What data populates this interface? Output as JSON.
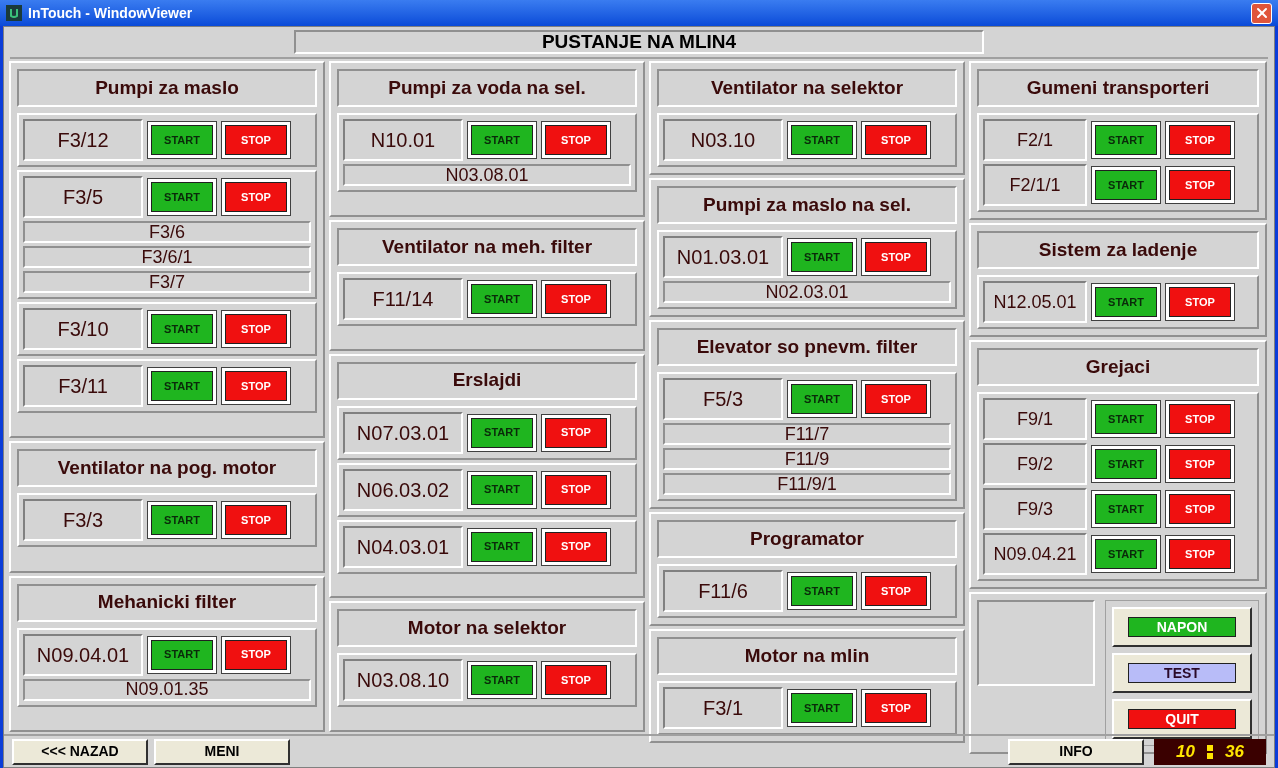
{
  "window": {
    "title": "InTouch - WindowViewer"
  },
  "header": {
    "title": "PUSTANJE NA  MLIN4"
  },
  "columns": [
    {
      "groups": [
        {
          "title": "Pumpi za maslo",
          "boxes": [
            {
              "units": [
                {
                  "label": "F3/12",
                  "start": "START",
                  "stop": "STOP"
                }
              ]
            },
            {
              "units": [
                {
                  "label": "F3/5",
                  "start": "START",
                  "stop": "STOP"
                }
              ],
              "notes": [
                "F3/6",
                "F3/6/1",
                "F3/7"
              ]
            },
            {
              "units": [
                {
                  "label": "F3/10",
                  "start": "START",
                  "stop": "STOP"
                }
              ]
            },
            {
              "units": [
                {
                  "label": "F3/11",
                  "start": "START",
                  "stop": "STOP"
                }
              ]
            }
          ]
        },
        {
          "title": "Ventilator na pog. motor",
          "boxes": [
            {
              "units": [
                {
                  "label": "F3/3",
                  "start": "START",
                  "stop": "STOP"
                }
              ]
            }
          ]
        },
        {
          "title": "Mehanicki filter",
          "boxes": [
            {
              "units": [
                {
                  "label": "N09.04.01",
                  "start": "START",
                  "stop": "STOP"
                }
              ],
              "notes": [
                "N09.01.35"
              ]
            }
          ]
        }
      ]
    },
    {
      "groups": [
        {
          "title": "Pumpi za voda na sel.",
          "boxes": [
            {
              "units": [
                {
                  "label": "N10.01",
                  "start": "START",
                  "stop": "STOP"
                }
              ],
              "notes": [
                "N03.08.01"
              ]
            }
          ]
        },
        {
          "title": "Ventilator na meh. filter",
          "boxes": [
            {
              "units": [
                {
                  "label": "F11/14",
                  "start": "START",
                  "stop": "STOP"
                }
              ]
            }
          ]
        },
        {
          "title": "Erslajdi",
          "boxes": [
            {
              "units": [
                {
                  "label": "N07.03.01",
                  "start": "START",
                  "stop": "STOP"
                }
              ]
            },
            {
              "units": [
                {
                  "label": "N06.03.02",
                  "start": "START",
                  "stop": "STOP"
                }
              ]
            },
            {
              "units": [
                {
                  "label": "N04.03.01",
                  "start": "START",
                  "stop": "STOP"
                }
              ]
            }
          ]
        },
        {
          "title": "Motor na selektor",
          "boxes": [
            {
              "units": [
                {
                  "label": "N03.08.10",
                  "start": "START",
                  "stop": "STOP"
                }
              ]
            }
          ]
        }
      ]
    },
    {
      "groups": [
        {
          "title": "Ventilator na selektor",
          "boxes": [
            {
              "units": [
                {
                  "label": "N03.10",
                  "start": "START",
                  "stop": "STOP"
                }
              ]
            }
          ]
        },
        {
          "title": "Pumpi za maslo na sel.",
          "boxes": [
            {
              "units": [
                {
                  "label": "N01.03.01",
                  "start": "START",
                  "stop": "STOP"
                }
              ],
              "notes": [
                "N02.03.01"
              ]
            }
          ]
        },
        {
          "title": "Elevator so pnevm. filter",
          "boxes": [
            {
              "units": [
                {
                  "label": "F5/3",
                  "start": "START",
                  "stop": "STOP"
                }
              ],
              "notes": [
                "F11/7",
                "F11/9",
                "F11/9/1"
              ]
            }
          ]
        },
        {
          "title": "Programator",
          "boxes": [
            {
              "units": [
                {
                  "label": "F11/6",
                  "start": "START",
                  "stop": "STOP"
                }
              ]
            }
          ]
        },
        {
          "title": "Motor na mlin",
          "boxes": [
            {
              "units": [
                {
                  "label": "F3/1",
                  "start": "START",
                  "stop": "STOP"
                }
              ]
            }
          ]
        }
      ]
    },
    {
      "groups": [
        {
          "title": "Gumeni transporteri",
          "boxes": [
            {
              "units": [
                {
                  "label": "F2/1",
                  "start": "START",
                  "stop": "STOP"
                },
                {
                  "label": "F2/1/1",
                  "start": "START",
                  "stop": "STOP"
                }
              ]
            }
          ]
        },
        {
          "title": "Sistem za ladenje",
          "boxes": [
            {
              "units": [
                {
                  "label": "N12.05.01",
                  "start": "START",
                  "stop": "STOP"
                }
              ]
            }
          ]
        },
        {
          "title": "Grejaci",
          "boxes": [
            {
              "units": [
                {
                  "label": "F9/1",
                  "start": "START",
                  "stop": "STOP"
                },
                {
                  "label": "F9/2",
                  "start": "START",
                  "stop": "STOP"
                },
                {
                  "label": "F9/3",
                  "start": "START",
                  "stop": "STOP"
                },
                {
                  "label": "N09.04.21",
                  "start": "START",
                  "stop": "STOP"
                }
              ]
            }
          ]
        }
      ]
    }
  ],
  "control_panel": {
    "buttons": [
      {
        "label": "NAPON",
        "color": "#1fb51f"
      },
      {
        "label": "TEST",
        "color": "#b8bcf8"
      },
      {
        "label": "QUIT",
        "color": "#f01010"
      }
    ]
  },
  "bottom_bar": {
    "left_buttons": [
      "<<< NAZAD",
      "MENI"
    ],
    "info_button": "INFO",
    "clock": {
      "hours": "10",
      "minutes": "36"
    }
  }
}
